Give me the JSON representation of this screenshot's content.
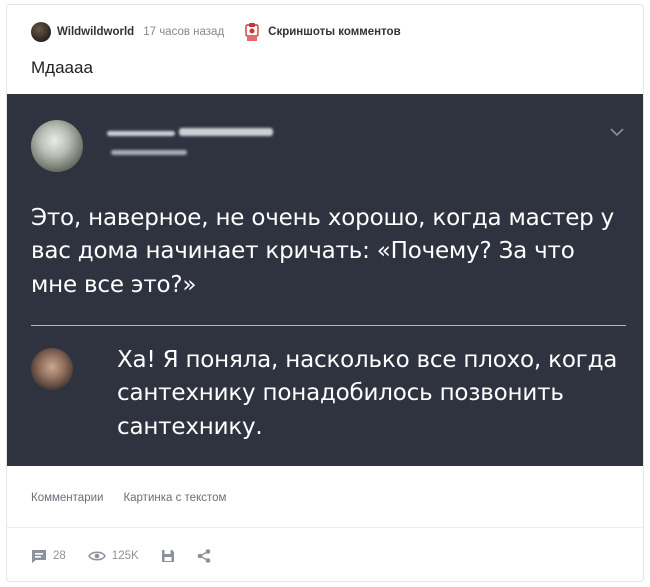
{
  "post": {
    "author": "Wildwildworld",
    "time": "17 часов назад",
    "community": "Скриншоты комментов",
    "title": "Мдаааа"
  },
  "screenshot": {
    "comment1": "Это, наверное, не очень хорошо, когда мастер у вас дома начинает кричать: «Почему? За что мне все это?»",
    "comment2": "Ха! Я поняла, насколько все плохо, когда сантехнику понадобилось позвонить сантехнику."
  },
  "tags": [
    "Комментарии",
    "Картинка с текстом"
  ],
  "actions": {
    "comments": "28",
    "views": "125K"
  },
  "colors": {
    "screenshot_bg": "#2f3340",
    "icon_gray": "#8b929c"
  }
}
